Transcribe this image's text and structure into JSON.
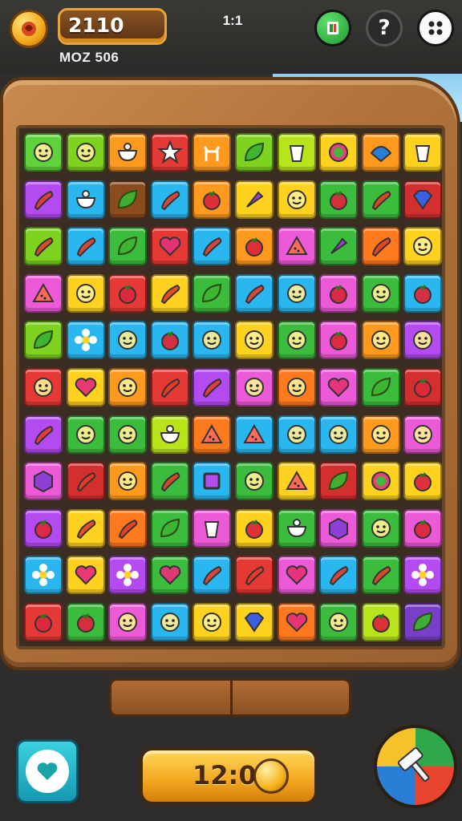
{
  "header": {
    "score": "2110",
    "sub_label": "MOZ 506",
    "center_label": "1:1",
    "icons": {
      "coin": "coin-icon",
      "flag": "flag-icon",
      "help": "help-icon",
      "menu": "menu-icon"
    },
    "help_label": "?"
  },
  "board": {
    "rows": [
      [
        "#5fd33b",
        "#7ed321",
        "#ff9a1f",
        "#e53935",
        "#ff9a1f",
        "#7ed321",
        "#b9e31a",
        "#ffd21f",
        "#ff9a1f",
        "#ffd21f"
      ],
      [
        "#b44bf0",
        "#2ab7f0",
        "#8a4b1e",
        "#2ab7f0",
        "#ff9a1f",
        "#ffd21f",
        "#ffd21f",
        "#3cbc3c",
        "#3cbc3c",
        "#d32f2f"
      ],
      [
        "#7ed321",
        "#2ab7f0",
        "#3cbc3c",
        "#e53935",
        "#2ab7f0",
        "#ff9a1f",
        "#ec5ad8",
        "#3cbc3c",
        "#ff7a1f",
        "#ffd21f"
      ],
      [
        "#ec5ad8",
        "#ffd21f",
        "#e53935",
        "#ffd21f",
        "#3cbc3c",
        "#2ab7f0",
        "#2ab7f0",
        "#ec5ad8",
        "#3cbc3c",
        "#2ab7f0"
      ],
      [
        "#7ed321",
        "#2ab7f0",
        "#2ab7f0",
        "#2ab7f0",
        "#2ab7f0",
        "#ffd21f",
        "#3cbc3c",
        "#ec5ad8",
        "#ff9a1f",
        "#b44bf0"
      ],
      [
        "#e53935",
        "#ffd21f",
        "#ff9a1f",
        "#e53935",
        "#b44bf0",
        "#ec5ad8",
        "#ff7a1f",
        "#ec5ad8",
        "#3cbc3c",
        "#d32f2f"
      ],
      [
        "#b44bf0",
        "#3cbc3c",
        "#3cbc3c",
        "#b9e31a",
        "#ff7a1f",
        "#2ab7f0",
        "#2ab7f0",
        "#2ab7f0",
        "#ff9a1f",
        "#ec5ad8"
      ],
      [
        "#ec5ad8",
        "#d32f2f",
        "#ff9a1f",
        "#3cbc3c",
        "#2ab7f0",
        "#3cbc3c",
        "#ffd21f",
        "#d32f2f",
        "#ffd21f",
        "#ffd21f"
      ],
      [
        "#b44bf0",
        "#ffd21f",
        "#ff7a1f",
        "#3cbc3c",
        "#ec5ad8",
        "#ffd21f",
        "#3cbc3c",
        "#ec5ad8",
        "#3cbc3c",
        "#ec5ad8"
      ],
      [
        "#2ab7f0",
        "#ffd21f",
        "#b44bf0",
        "#3cbc3c",
        "#2ab7f0",
        "#e53935",
        "#ec5ad8",
        "#2ab7f0",
        "#3cbc3c",
        "#b44bf0"
      ],
      [
        "#e53935",
        "#3cbc3c",
        "#ec5ad8",
        "#2ab7f0",
        "#ffd21f",
        "#ffd21f",
        "#ff7a1f",
        "#3cbc3c",
        "#b9e31a",
        "#7a3fc8"
      ]
    ],
    "glyphs": [
      [
        "face",
        "face",
        "bowl",
        "star",
        "deer",
        "leaf",
        "cup",
        "ring",
        "dome",
        "cup"
      ],
      [
        "pepper",
        "bowl",
        "leaf",
        "pepper",
        "berry",
        "carrot",
        "face",
        "berry",
        "pepper",
        "gem"
      ],
      [
        "pepper",
        "pepper",
        "leaf",
        "heart",
        "pepper",
        "berry",
        "slice",
        "carrot",
        "pepper",
        "face"
      ],
      [
        "slice",
        "face",
        "berry",
        "pepper",
        "leaf",
        "pepper",
        "face",
        "berry",
        "face",
        "berry"
      ],
      [
        "leaf",
        "flower",
        "face",
        "berry",
        "face",
        "face",
        "face",
        "berry",
        "face",
        "face"
      ],
      [
        "face",
        "heart",
        "face",
        "pepper",
        "pepper",
        "face",
        "face",
        "heart",
        "leaf",
        "berry"
      ],
      [
        "pepper",
        "face",
        "face",
        "bowl",
        "slice",
        "slice",
        "face",
        "face",
        "face",
        "face"
      ],
      [
        "cube",
        "pepper",
        "face",
        "pepper",
        "square",
        "face",
        "slice",
        "leaf",
        "ring",
        "berry"
      ],
      [
        "berry",
        "pepper",
        "pepper",
        "leaf",
        "cup",
        "berry",
        "bowl",
        "cube",
        "face",
        "berry"
      ],
      [
        "flower",
        "heart",
        "flower",
        "heart",
        "pepper",
        "pepper",
        "heart",
        "pepper",
        "pepper",
        "flower"
      ],
      [
        "berry",
        "berry",
        "face",
        "face",
        "face",
        "gem",
        "heart",
        "face",
        "berry",
        "leaf"
      ]
    ]
  },
  "footer": {
    "timer": "12:0",
    "icons": {
      "heart": "heart-icon",
      "coin": "coin-icon",
      "hammer": "hammer-icon"
    }
  }
}
